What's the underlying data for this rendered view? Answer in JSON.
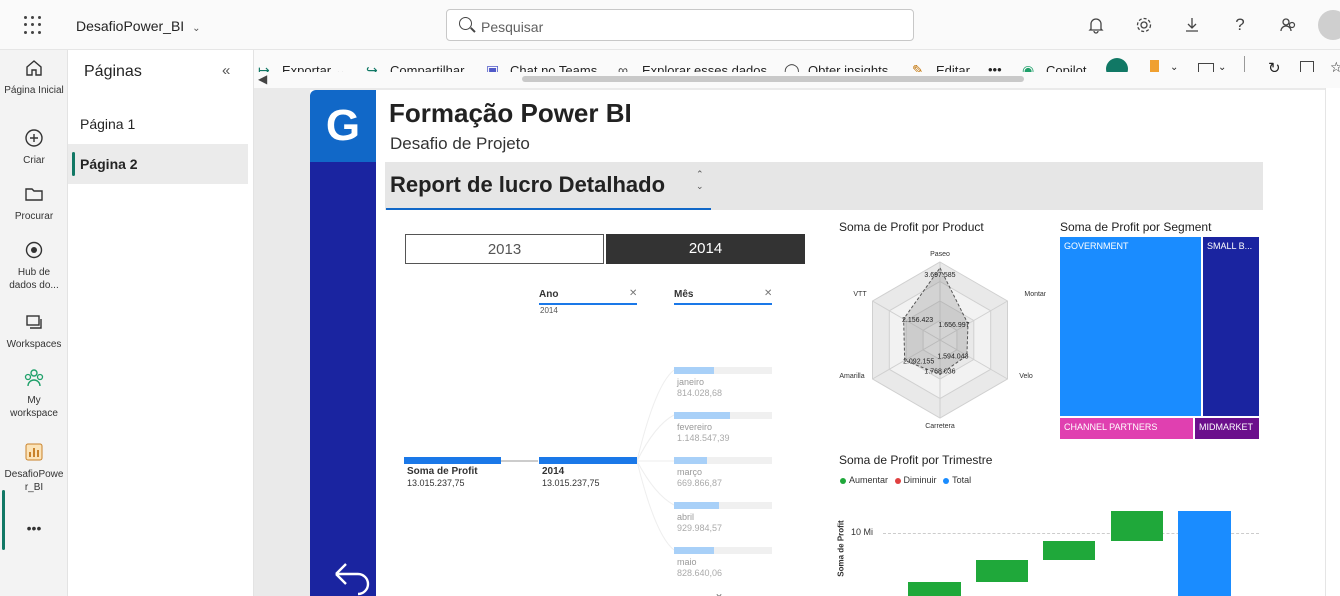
{
  "topbar": {
    "workspace": "DesafioPower_BI",
    "search_placeholder": "Pesquisar"
  },
  "rail": {
    "items": [
      {
        "label": "Página Inicial",
        "icon": "home-icon"
      },
      {
        "label": "Criar",
        "icon": "plus-circle-icon"
      },
      {
        "label": "Procurar",
        "icon": "folder-icon"
      },
      {
        "label": "Hub de dados do...",
        "icon": "data-hub-icon"
      },
      {
        "label": "Workspaces",
        "icon": "workspaces-icon"
      },
      {
        "label": "My workspace",
        "icon": "people-icon"
      },
      {
        "label": "DesafioPower_BI",
        "icon": "report-icon"
      },
      {
        "label": "•••",
        "icon": "more-icon"
      }
    ]
  },
  "pages": {
    "title": "Páginas",
    "items": [
      "Página 1",
      "Página 2"
    ],
    "selected": "Página 2"
  },
  "commands": [
    "Exportar",
    "Compartilhar",
    "Chat no Teams",
    "Explorar esses dados",
    "Obter insights",
    "Editar",
    "•••",
    "Copilot"
  ],
  "report": {
    "logo": "G",
    "title": "Formação Power BI",
    "subtitle": "Desafio de Projeto",
    "header": "Report de lucro Detalhado"
  },
  "years": {
    "options": [
      "2013",
      "2014"
    ],
    "selected": "2014"
  },
  "decomposition": {
    "root_label": "Soma de Profit",
    "root_value": "13.015.237,75",
    "level1_header": "Ano",
    "level1_filter": "2014",
    "level1_label": "2014",
    "level1_value": "13.015.237,75",
    "level2_header": "Mês",
    "months": [
      {
        "name": "janeiro",
        "value": "814.028,68",
        "frac": 0.41
      },
      {
        "name": "fevereiro",
        "value": "1.148.547,39",
        "frac": 0.57
      },
      {
        "name": "março",
        "value": "669.866,87",
        "frac": 0.34
      },
      {
        "name": "abril",
        "value": "929.984,57",
        "frac": 0.46
      },
      {
        "name": "maio",
        "value": "828.640,06",
        "frac": 0.41
      }
    ]
  },
  "radar": {
    "title": "Soma de Profit por Product",
    "axes": [
      "Paseo",
      "Montana",
      "Velo",
      "Carretera",
      "Amarilla",
      "VTT"
    ],
    "values": [
      "3.697.585",
      "1.656.997",
      "1.594.043",
      "1.768.036",
      "2.092.155",
      "2.156.423"
    ],
    "numbers": [
      3697585,
      1656997,
      1594043,
      1768036,
      2092155,
      2156423
    ]
  },
  "treemap": {
    "title": "Soma de Profit por Segment",
    "segments": [
      {
        "name": "GOVERNMENT",
        "color": "#1a8cff"
      },
      {
        "name": "SMALL B...",
        "color": "#1a24a0"
      },
      {
        "name": "CHANNEL PARTNERS",
        "color": "#e040b0"
      },
      {
        "name": "MIDMARKET",
        "color": "#6b0f8c"
      }
    ]
  },
  "waterfall": {
    "title": "Soma de Profit por Trimestre",
    "legend": [
      {
        "label": "Aumentar",
        "color": "#1fa83a"
      },
      {
        "label": "Diminuir",
        "color": "#e04040"
      },
      {
        "label": "Total",
        "color": "#1a8cff"
      }
    ],
    "ylabel": "Soma de Profit",
    "ytick": "10 Mi"
  },
  "chart_data": {
    "type": "radar",
    "title": "Soma de Profit por Product",
    "categories": [
      "Paseo",
      "Montana",
      "Velo",
      "Carretera",
      "Amarilla",
      "VTT"
    ],
    "values": [
      3697585,
      1656997,
      1594043,
      1768036,
      2092155,
      2156423
    ]
  }
}
